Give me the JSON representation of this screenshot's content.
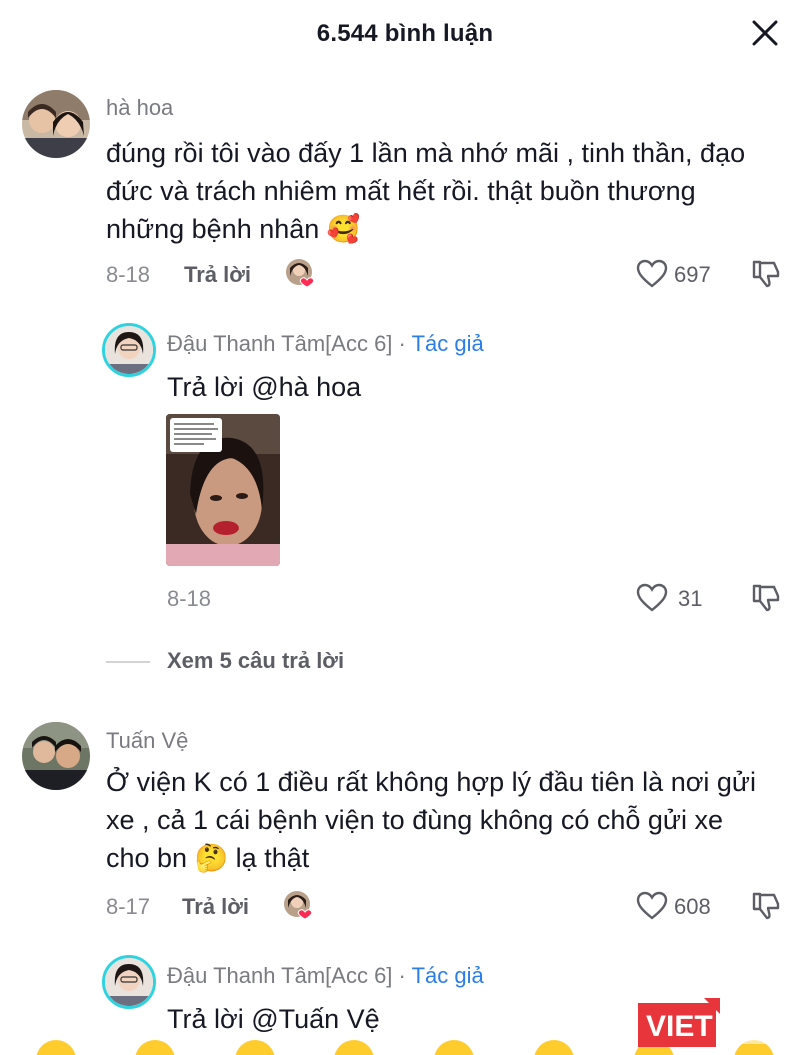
{
  "header": {
    "title": "6.544 bình luận"
  },
  "comments": [
    {
      "username": "hà hoa",
      "text": "đúng rồi tôi vào đấy 1 lần mà nhớ mãi , tinh thần, đạo đức và trách nhiêm mất hết rồi. thật buồn thương những bệnh nhân 🥰",
      "date": "8-18",
      "reply_label": "Trả lời",
      "likes": "697",
      "reply": {
        "username": "Đậu Thanh Tâm[Acc 6]",
        "separator": "·",
        "author_tag": "Tác giả",
        "text": "Trả lời @hà hoa",
        "date": "8-18",
        "likes": "31"
      },
      "view_more": "Xem 5 câu trả lời"
    },
    {
      "username": "Tuấn Vệ",
      "text": "Ở viện K có 1 điều rất không hợp lý đầu tiên là nơi gửi xe , cả 1 cái bệnh viện to đùng không có chỗ gửi xe cho bn 🤔  lạ thật",
      "date": "8-17",
      "reply_label": "Trả lời",
      "likes": "608",
      "reply": {
        "username": "Đậu Thanh Tâm[Acc 6]",
        "separator": "·",
        "author_tag": "Tác giả",
        "text": "Trả lời @Tuấn Vệ"
      }
    }
  ],
  "watermark": {
    "text": "VIET"
  },
  "colors": {
    "author_tag": "#2b7de9",
    "avatar_ring": "#2fd3e0",
    "heart": "#fe2c55",
    "watermark": "#e8353c"
  },
  "icons": [
    "close-icon",
    "heart-outline-icon",
    "dislike-icon",
    "liked-by-creator-icon"
  ]
}
